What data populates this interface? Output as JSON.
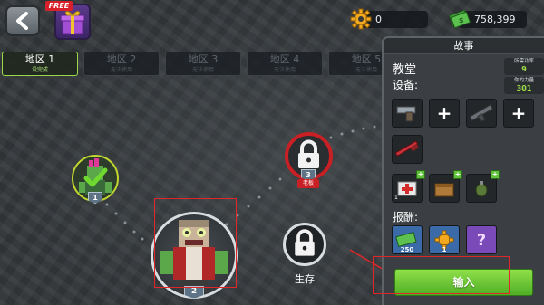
{
  "header": {
    "free_label": "FREE",
    "gears_value": "0",
    "cash_value": "758,399"
  },
  "tabs": [
    {
      "name": "地区 1",
      "status": "设完成"
    },
    {
      "name": "地区 2",
      "status": "无法使用"
    },
    {
      "name": "地区 3",
      "status": "无法使用"
    },
    {
      "name": "地区 4",
      "status": "无法使用"
    },
    {
      "name": "地区 5",
      "status": "无法使用"
    }
  ],
  "map": {
    "nodes": [
      {
        "badge": "1",
        "state": "completed"
      },
      {
        "badge": "2",
        "state": "selected"
      },
      {
        "badge": "3",
        "state": "locked",
        "tag": "老板"
      },
      {
        "label": "生存",
        "state": "locked"
      }
    ]
  },
  "panel": {
    "title": "故事",
    "location": "教堂",
    "equipment_label": "设备:",
    "rewards_label": "报酬:",
    "stat_1": {
      "label": "所需功率",
      "value": "9"
    },
    "stat_2": {
      "label": "你的力量",
      "value": "301"
    },
    "consumables": [
      "1",
      "",
      ""
    ],
    "rewards": [
      "250",
      "1",
      ""
    ],
    "enter_label": "输入"
  },
  "colors": {
    "accent_green": "#6cc531",
    "highlight_red": "#e0262a",
    "boss_red": "#c82024",
    "panel_bg": "#3b3f43"
  }
}
